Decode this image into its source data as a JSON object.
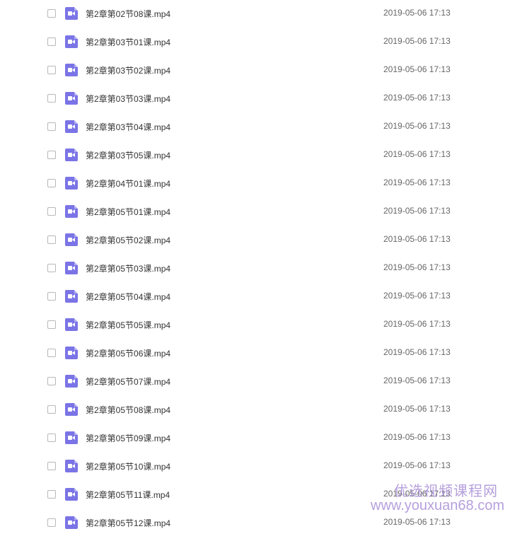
{
  "files": [
    {
      "name": "第2章第02节08课.mp4",
      "date": "2019-05-06 17:13"
    },
    {
      "name": "第2章第03节01课.mp4",
      "date": "2019-05-06 17:13"
    },
    {
      "name": "第2章第03节02课.mp4",
      "date": "2019-05-06 17:13"
    },
    {
      "name": "第2章第03节03课.mp4",
      "date": "2019-05-06 17:13"
    },
    {
      "name": "第2章第03节04课.mp4",
      "date": "2019-05-06 17:13"
    },
    {
      "name": "第2章第03节05课.mp4",
      "date": "2019-05-06 17:13"
    },
    {
      "name": "第2章第04节01课.mp4",
      "date": "2019-05-06 17:13"
    },
    {
      "name": "第2章第05节01课.mp4",
      "date": "2019-05-06 17:13"
    },
    {
      "name": "第2章第05节02课.mp4",
      "date": "2019-05-06 17:13"
    },
    {
      "name": "第2章第05节03课.mp4",
      "date": "2019-05-06 17:13"
    },
    {
      "name": "第2章第05节04课.mp4",
      "date": "2019-05-06 17:13"
    },
    {
      "name": "第2章第05节05课.mp4",
      "date": "2019-05-06 17:13"
    },
    {
      "name": "第2章第05节06课.mp4",
      "date": "2019-05-06 17:13"
    },
    {
      "name": "第2章第05节07课.mp4",
      "date": "2019-05-06 17:13"
    },
    {
      "name": "第2章第05节08课.mp4",
      "date": "2019-05-06 17:13"
    },
    {
      "name": "第2章第05节09课.mp4",
      "date": "2019-05-06 17:13"
    },
    {
      "name": "第2章第05节10课.mp4",
      "date": "2019-05-06 17:13"
    },
    {
      "name": "第2章第05节11课.mp4",
      "date": "2019-05-06 17:13"
    },
    {
      "name": "第2章第05节12课.mp4",
      "date": "2019-05-06 17:13"
    }
  ],
  "icon": "video-file-icon",
  "accent_color": "#7b74e6",
  "watermark": {
    "text_cn": "优选视频课程网",
    "url": "www.youxuan68.com"
  }
}
